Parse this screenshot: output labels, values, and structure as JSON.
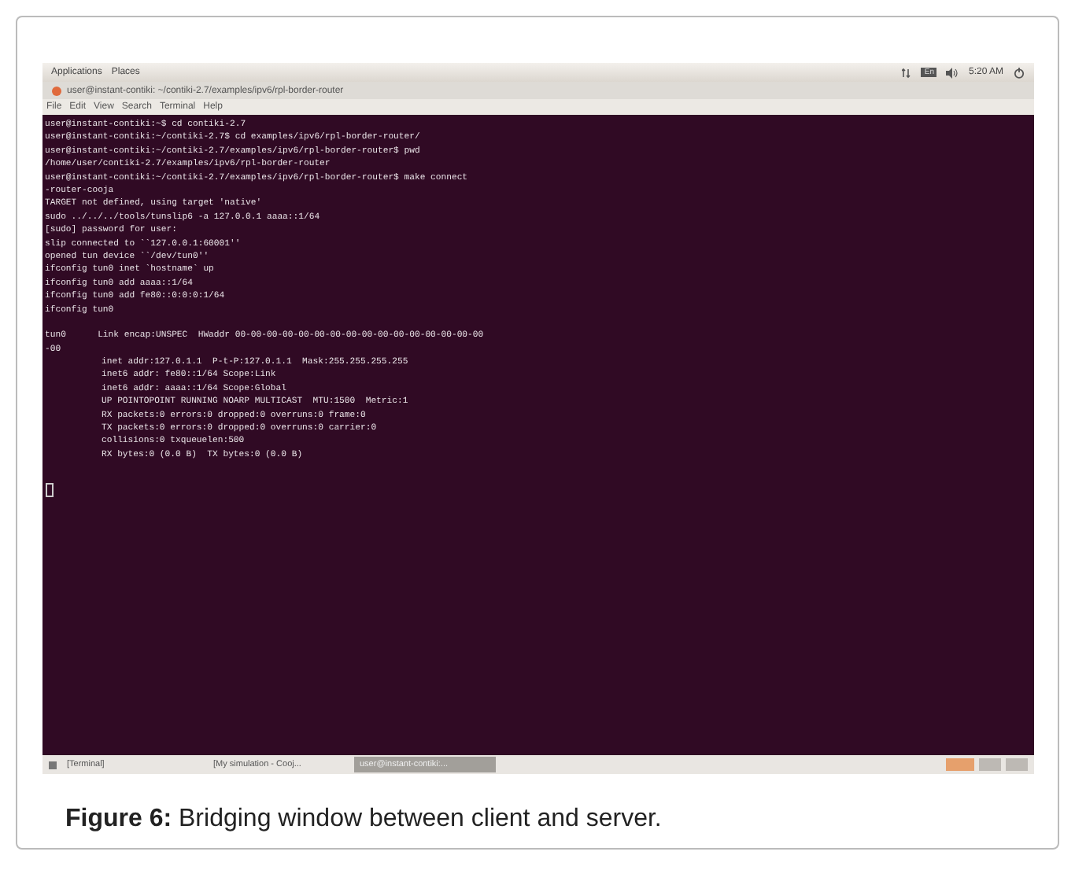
{
  "top_panel": {
    "menus": [
      "Applications",
      "Places"
    ],
    "keyboard": "En",
    "time": "5:20 AM"
  },
  "window": {
    "title": "user@instant-contiki: ~/contiki-2.7/examples/ipv6/rpl-border-router"
  },
  "menu_bar": [
    "File",
    "Edit",
    "View",
    "Search",
    "Terminal",
    "Help"
  ],
  "terminal": {
    "blocks": [
      [
        {
          "kind": "plain",
          "text": "user@instant-contiki:~$ cd contiki-2.7"
        },
        {
          "kind": "plain",
          "text": "user@instant-contiki:~/contiki-2.7$ cd examples/ipv6/rpl-border-router/"
        },
        {
          "kind": "plain",
          "text": "user@instant-contiki:~/contiki-2.7/examples/ipv6/rpl-border-router$ pwd"
        },
        {
          "kind": "plain",
          "text": "/home/user/contiki-2.7/examples/ipv6/rpl-border-router"
        },
        {
          "kind": "plain",
          "text": "user@instant-contiki:~/contiki-2.7/examples/ipv6/rpl-border-router$ make connect"
        },
        {
          "kind": "plain",
          "text": "-router-cooja"
        },
        {
          "kind": "plain",
          "text": "TARGET not defined, using target 'native'"
        },
        {
          "kind": "plain",
          "text": "sudo ../../../tools/tunslip6 -a 127.0.0.1 aaaa::1/64"
        },
        {
          "kind": "plain",
          "text": "[sudo] password for user:"
        },
        {
          "kind": "plain",
          "text": "slip connected to ``127.0.0.1:60001''"
        },
        {
          "kind": "plain",
          "text": "opened tun device ``/dev/tun0''"
        },
        {
          "kind": "plain",
          "text": "ifconfig tun0 inet `hostname` up"
        },
        {
          "kind": "plain",
          "text": "ifconfig tun0 add aaaa::1/64"
        },
        {
          "kind": "plain",
          "text": "ifconfig tun0 add fe80::0:0:0:1/64"
        },
        {
          "kind": "plain",
          "text": "ifconfig tun0"
        }
      ],
      [
        {
          "kind": "plain",
          "text": "tun0      Link encap:UNSPEC  HWaddr 00-00-00-00-00-00-00-00-00-00-00-00-00-00-00-00"
        },
        {
          "kind": "plain",
          "text": "-00"
        },
        {
          "kind": "indented",
          "text": "inet addr:127.0.1.1  P-t-P:127.0.1.1  Mask:255.255.255.255"
        },
        {
          "kind": "indented",
          "text": "inet6 addr: fe80::1/64 Scope:Link"
        },
        {
          "kind": "indented",
          "text": "inet6 addr: aaaa::1/64 Scope:Global"
        },
        {
          "kind": "indented",
          "text": "UP POINTOPOINT RUNNING NOARP MULTICAST  MTU:1500  Metric:1"
        },
        {
          "kind": "indented",
          "text": "RX packets:0 errors:0 dropped:0 overruns:0 frame:0"
        },
        {
          "kind": "indented",
          "text": "TX packets:0 errors:0 dropped:0 overruns:0 carrier:0"
        },
        {
          "kind": "indented",
          "text": "collisions:0 txqueuelen:500"
        },
        {
          "kind": "indented",
          "text": "RX bytes:0 (0.0 B)  TX bytes:0 (0.0 B)"
        }
      ]
    ]
  },
  "taskbar": {
    "items": [
      {
        "label": "[Terminal]",
        "selected": false
      },
      {
        "label": "[My simulation - Cooj...",
        "selected": false
      },
      {
        "label": "user@instant-contiki:...",
        "selected": true
      }
    ]
  },
  "caption": "**Figure 6:** Bridging window between client and server."
}
